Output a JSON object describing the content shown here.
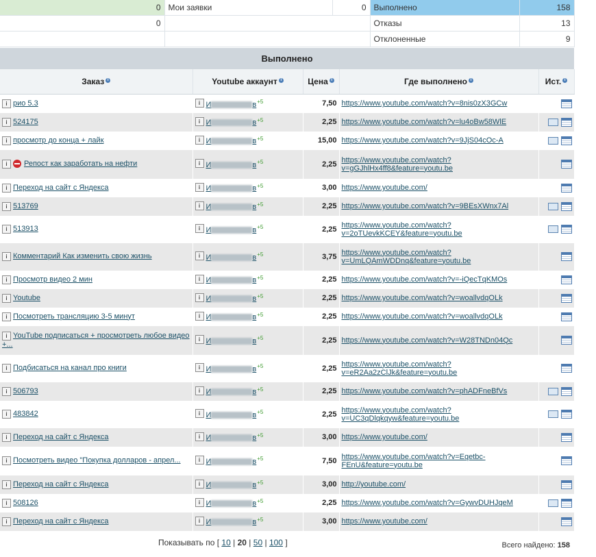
{
  "summary": {
    "left_value_1": "0",
    "left_value_2": "0",
    "my_requests_label": "Мои заявки",
    "my_requests_value": "0",
    "stats": [
      {
        "label": "Выполнено",
        "value": "158"
      },
      {
        "label": "Отказы",
        "value": "13"
      },
      {
        "label": "Отклоненные",
        "value": "9"
      }
    ]
  },
  "section_title": "Выполнено",
  "columns": {
    "order": "Заказ",
    "account": "Youtube аккаунт",
    "price": "Цена",
    "where": "Где выполнено",
    "source": "Ист."
  },
  "account_prefix": "И",
  "account_suffix": "в",
  "bonus": "+5",
  "rows": [
    {
      "order": "рио 5.3",
      "price": "7,50",
      "url1": "https://www.youtube.com/watch?v=8nis0zX3GCw",
      "url2": "",
      "mail": false,
      "stop": false
    },
    {
      "order": "524175",
      "price": "2,25",
      "url1": "https://www.youtube.com/watch?v=lu4oBw58WlE",
      "url2": "",
      "mail": true,
      "stop": false
    },
    {
      "order": "просмотр до конца + лайк",
      "price": "15,00",
      "url1": "https://www.youtube.com/watch?v=9JjS04cOc-A",
      "url2": "",
      "mail": true,
      "stop": false
    },
    {
      "order": "Репост как заработать на нефти",
      "price": "2,25",
      "url1": "https://www.youtube.com/watch?",
      "url2": "v=gGJhlHx4ff8&feature=youtu.be",
      "mail": false,
      "stop": true
    },
    {
      "order": "Переход на сайт с Яндекса",
      "price": "3,00",
      "url1": "https://www.youtube.com/",
      "url2": "",
      "mail": false,
      "stop": false
    },
    {
      "order": "513769",
      "price": "2,25",
      "url1": "https://www.youtube.com/watch?v=9BEsXWnx7Al",
      "url2": "",
      "mail": true,
      "stop": false
    },
    {
      "order": "513913",
      "price": "2,25",
      "url1": "https://www.youtube.com/watch?",
      "url2": "v=2oTUevkKCEY&feature=youtu.be",
      "mail": true,
      "stop": false
    },
    {
      "order": "Комментарий Как изменить свою жизнь",
      "price": "3,75",
      "url1": "https://www.youtube.com/watch?",
      "url2": "v=UmLQAmWDDnq&feature=youtu.be",
      "mail": false,
      "stop": false
    },
    {
      "order": "Просмотр видео 2 мин",
      "price": "2,25",
      "url1": "https://www.youtube.com/watch?v=-iQecTqKMOs",
      "url2": "",
      "mail": false,
      "stop": false
    },
    {
      "order": "Youtube",
      "price": "2,25",
      "url1": "https://www.youtube.com/watch?v=woallvdqOLk",
      "url2": "",
      "mail": false,
      "stop": false
    },
    {
      "order": "Посмотреть трансляцию 3-5 минут",
      "price": "2,25",
      "url1": "https://www.youtube.com/watch?v=woallvdqOLk",
      "url2": "",
      "mail": false,
      "stop": false
    },
    {
      "order": "YouTube подписаться + просмотреть любое видео +...",
      "price": "2,25",
      "url1": "https://www.youtube.com/watch?v=W28TNDn04Qc",
      "url2": "",
      "mail": false,
      "stop": false
    },
    {
      "order": "Подбисаться на канал про книги",
      "price": "2,25",
      "url1": "https://www.youtube.com/watch?",
      "url2": "v=eR2Aa2zClJk&feature=youtu.be",
      "mail": false,
      "stop": false
    },
    {
      "order": "506793",
      "price": "2,25",
      "url1": "https://www.youtube.com/watch?v=phADFneBfVs",
      "url2": "",
      "mail": true,
      "stop": false
    },
    {
      "order": "483842",
      "price": "2,25",
      "url1": "https://www.youtube.com/watch?",
      "url2": "v=UC3qDlqkqyw&feature=youtu.be",
      "mail": true,
      "stop": false
    },
    {
      "order": "Переход на сайт с Яндекса",
      "price": "3,00",
      "url1": "https://www.youtube.com/",
      "url2": "",
      "mail": false,
      "stop": false
    },
    {
      "order": "Посмотреть видео \"Покупка долларов - апрел...",
      "price": "7,50",
      "url1": "https://www.youtube.com/watch?v=Eqetbc-",
      "url2": "FEnU&feature=youtu.be",
      "mail": false,
      "stop": false
    },
    {
      "order": "Переход на сайт с Яндекса",
      "price": "3,00",
      "url1": "http://youtube.com/",
      "url2": "",
      "mail": false,
      "stop": false
    },
    {
      "order": "508126",
      "price": "2,25",
      "url1": "https://www.youtube.com/watch?v=GywvDUHJqeM",
      "url2": "",
      "mail": true,
      "stop": false
    },
    {
      "order": "Переход на сайт с Яндекса",
      "price": "3,00",
      "url1": "https://www.youtube.com/",
      "url2": "",
      "mail": false,
      "stop": false
    }
  ],
  "pager": {
    "label": "Показывать по",
    "open": "[",
    "close": "]",
    "sep": "|",
    "options": [
      "10",
      "20",
      "50",
      "100"
    ],
    "selected": "20"
  },
  "total": {
    "label": "Всего найдено:",
    "value": "158"
  },
  "colors": {
    "header_bg": "#cfd6dc",
    "stripe": "#e8e8e8",
    "highlight": "#91cbec",
    "green": "#d9ecd3"
  }
}
